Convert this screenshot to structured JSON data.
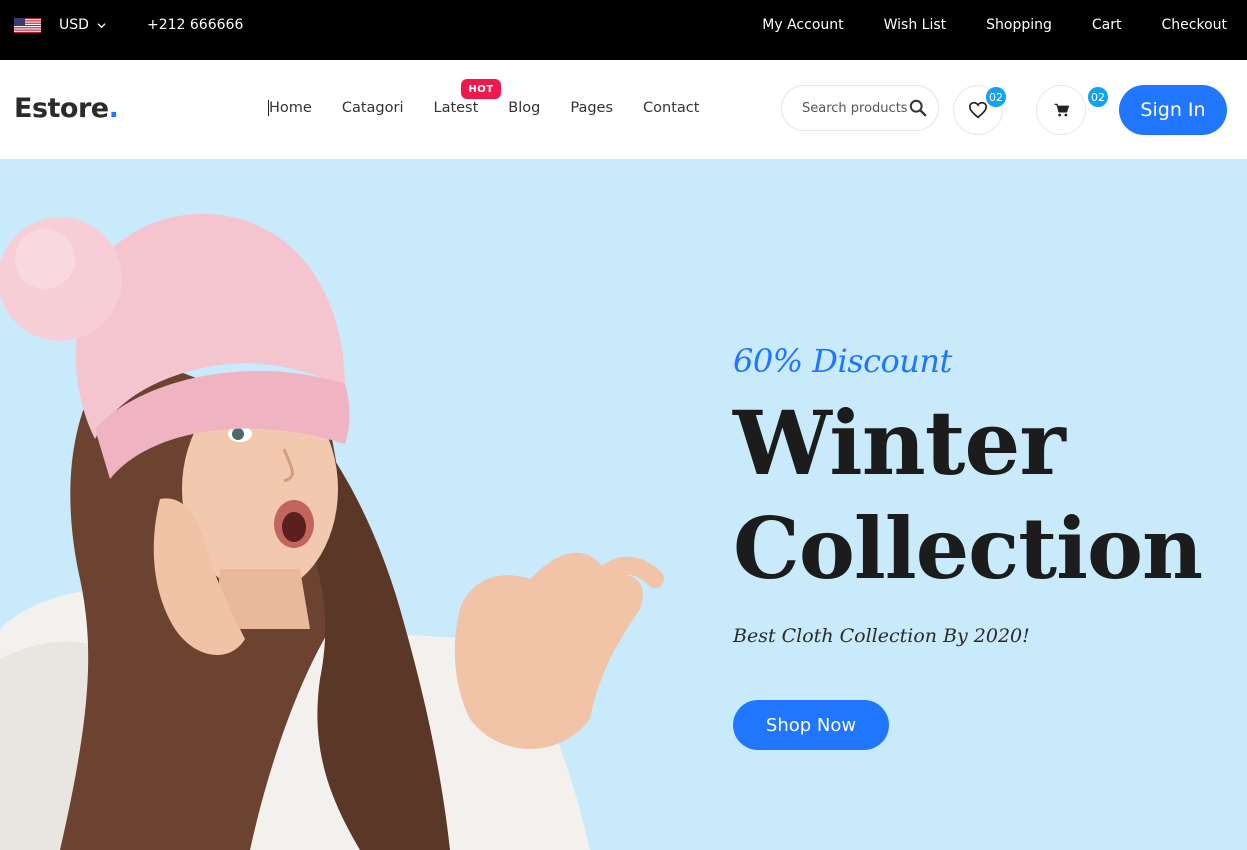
{
  "topbar": {
    "currency": "USD",
    "phone": "+212 666666",
    "links": [
      "My Account",
      "Wish List",
      "Shopping",
      "Cart",
      "Checkout"
    ]
  },
  "header": {
    "logo_text": "Estore",
    "logo_dot": ".",
    "nav": [
      "Home",
      "Catagori",
      "Latest",
      "Blog",
      "Pages",
      "Contact"
    ],
    "hot_badge": "HOT",
    "search_placeholder": "Search products",
    "wishlist_count": "02",
    "cart_count": "02",
    "signin_label": "Sign In"
  },
  "hero": {
    "discount": "60% Discount",
    "title_line1": "Winter",
    "title_line2": "Collection",
    "subtitle": "Best Cloth Collection By 2020!",
    "cta_label": "Shop Now"
  },
  "colors": {
    "accent": "#2176ff",
    "hero_bg": "#c8eafb",
    "hot": "#f0184d",
    "badge": "#13a2f2",
    "topbar": "#000000"
  },
  "icons": {
    "flag": "us-flag-icon",
    "currency_toggle": "chevron-down-icon",
    "search": "search-icon",
    "wishlist": "heart-icon",
    "cart": "cart-icon"
  }
}
